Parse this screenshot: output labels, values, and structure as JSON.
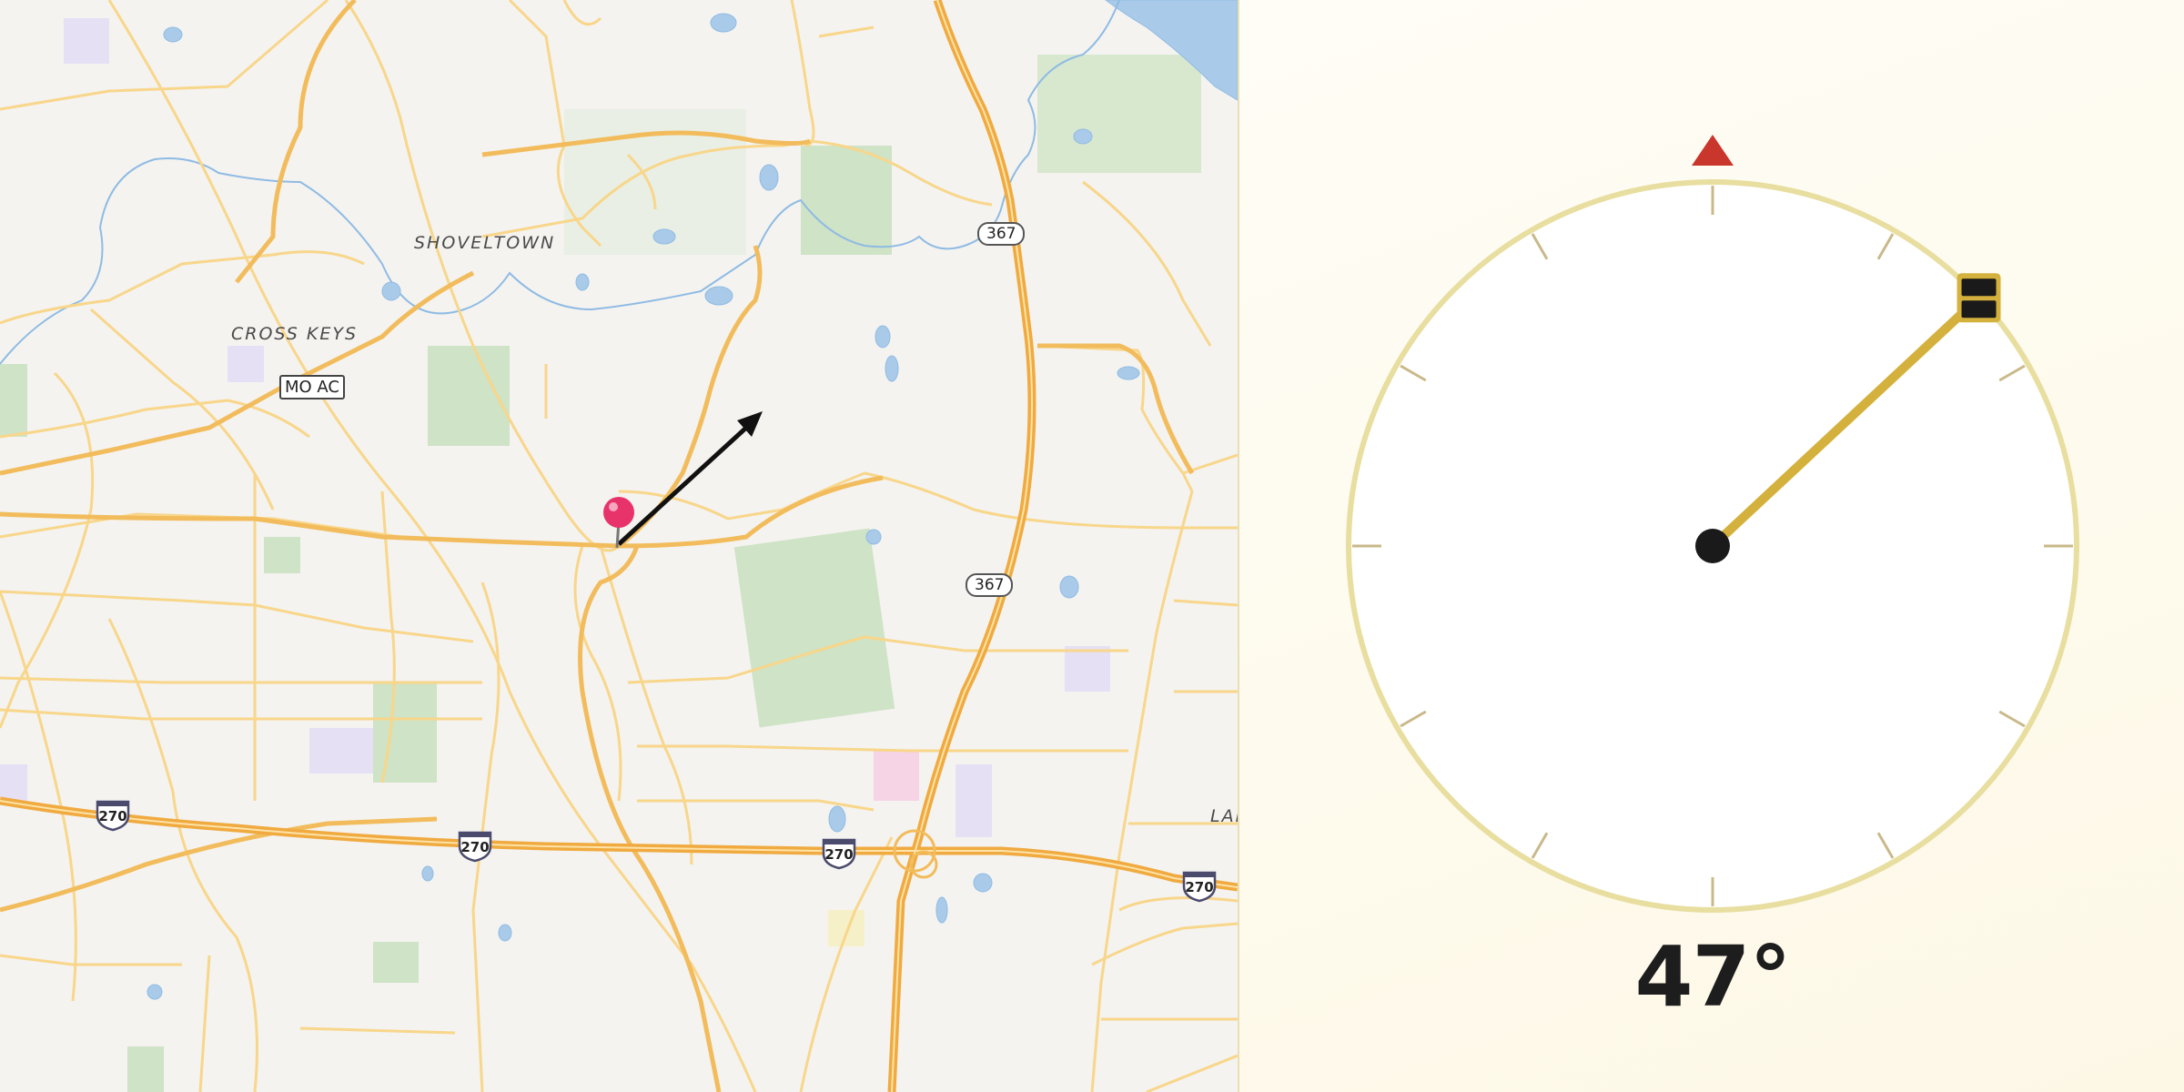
{
  "map": {
    "labels": {
      "shoveltown": "SHOVELTOWN",
      "cross_keys": "CROSS KEYS",
      "lar": "LAR"
    },
    "route_shields": {
      "mo_ac": "MO AC",
      "us367_north": "367",
      "us367_south": "367",
      "i270_a": "270",
      "i270_b": "270",
      "i270_c": "270",
      "i270_d": "270"
    },
    "marker": {
      "icon": "map-pin-icon",
      "color": "#e8336a"
    },
    "direction_arrow": {
      "icon": "bearing-arrow-icon",
      "bearing_deg": 47
    }
  },
  "dial": {
    "angle_text": "47°",
    "angle_value": 47,
    "north_marker_icon": "north-triangle-icon",
    "north_color": "#c9362c",
    "ring_color": "#e8deA0",
    "needle_color": "#d4b13c",
    "tick_count": 12
  }
}
